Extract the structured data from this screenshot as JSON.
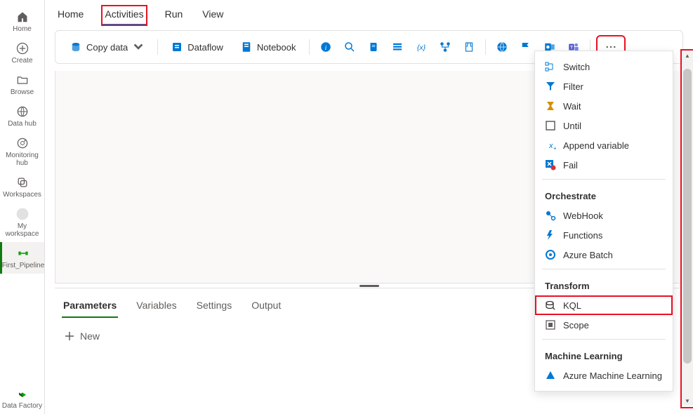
{
  "sidebar": {
    "items": [
      {
        "label": "Home"
      },
      {
        "label": "Create"
      },
      {
        "label": "Browse"
      },
      {
        "label": "Data hub"
      },
      {
        "label": "Monitoring hub"
      },
      {
        "label": "Workspaces"
      },
      {
        "label": "My workspace"
      },
      {
        "label": "First_Pipeline"
      },
      {
        "label": "Data Factory"
      }
    ]
  },
  "tabs": [
    "Home",
    "Activities",
    "Run",
    "View"
  ],
  "toolbar": {
    "copy_data": "Copy data",
    "dataflow": "Dataflow",
    "notebook": "Notebook"
  },
  "bottom": {
    "tabs": [
      "Parameters",
      "Variables",
      "Settings",
      "Output"
    ],
    "new_label": "New"
  },
  "dropdown": {
    "items_top": [
      {
        "label": "Switch"
      },
      {
        "label": "Filter"
      },
      {
        "label": "Wait"
      },
      {
        "label": "Until"
      },
      {
        "label": "Append variable"
      },
      {
        "label": "Fail"
      }
    ],
    "section_orchestrate": "Orchestrate",
    "items_orchestrate": [
      {
        "label": "WebHook"
      },
      {
        "label": "Functions"
      },
      {
        "label": "Azure Batch"
      }
    ],
    "section_transform": "Transform",
    "items_transform": [
      {
        "label": "KQL"
      },
      {
        "label": "Scope"
      }
    ],
    "section_ml": "Machine Learning",
    "items_ml": [
      {
        "label": "Azure Machine Learning"
      }
    ]
  }
}
